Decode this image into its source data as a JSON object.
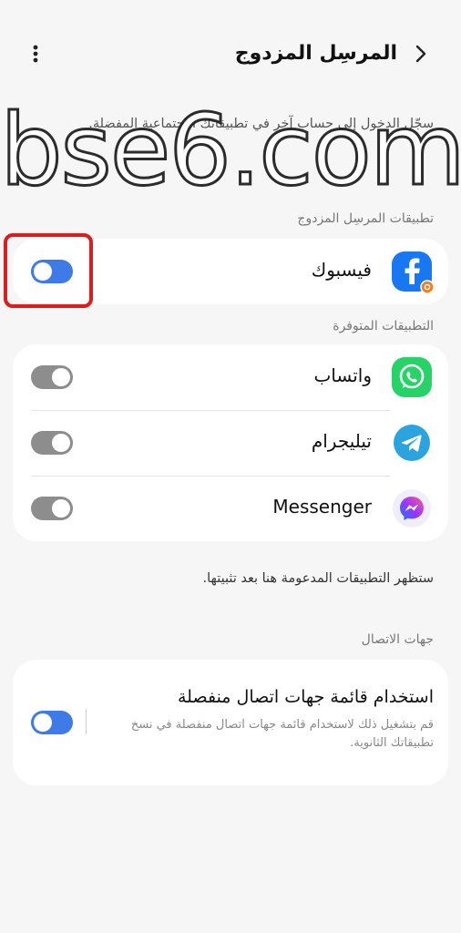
{
  "header": {
    "title": "المرسِل المزدوج",
    "back_icon": "chevron-right-icon",
    "more_icon": "more-vertical-icon"
  },
  "description": "سجّل الدخول إلى حساب آخر في تطبيقاتك الاجتماعية المفضلة.",
  "watermark": "bse6.com",
  "dual_section": {
    "label": "تطبيقات المرسِل المزدوج",
    "items": [
      {
        "name": "فيسبوك",
        "icon": "facebook-icon",
        "enabled": true
      }
    ]
  },
  "available_section": {
    "label": "التطبيقات المتوفرة",
    "items": [
      {
        "name": "واتساب",
        "icon": "whatsapp-icon",
        "enabled": false
      },
      {
        "name": "تيليجرام",
        "icon": "telegram-icon",
        "enabled": false
      },
      {
        "name": "Messenger",
        "icon": "messenger-icon",
        "enabled": false
      }
    ]
  },
  "note": "ستظهر التطبيقات المدعومة هنا بعد تثبيتها.",
  "contacts_section": {
    "label": "جهات الاتصال",
    "title": "استخدام قائمة جهات اتصال منفصلة",
    "desc": "قم بتشغيل ذلك لاستخدام قائمة جهات اتصال منفصلة في نسخ تطبيقاتك الثانوية.",
    "enabled": true
  },
  "colors": {
    "accent": "#3e7ae8",
    "toggle_off": "#8d8d8d",
    "highlight": "#e01b1b",
    "facebook": "#1877f2",
    "whatsapp": "#25d366",
    "telegram": "#2aa3df"
  }
}
